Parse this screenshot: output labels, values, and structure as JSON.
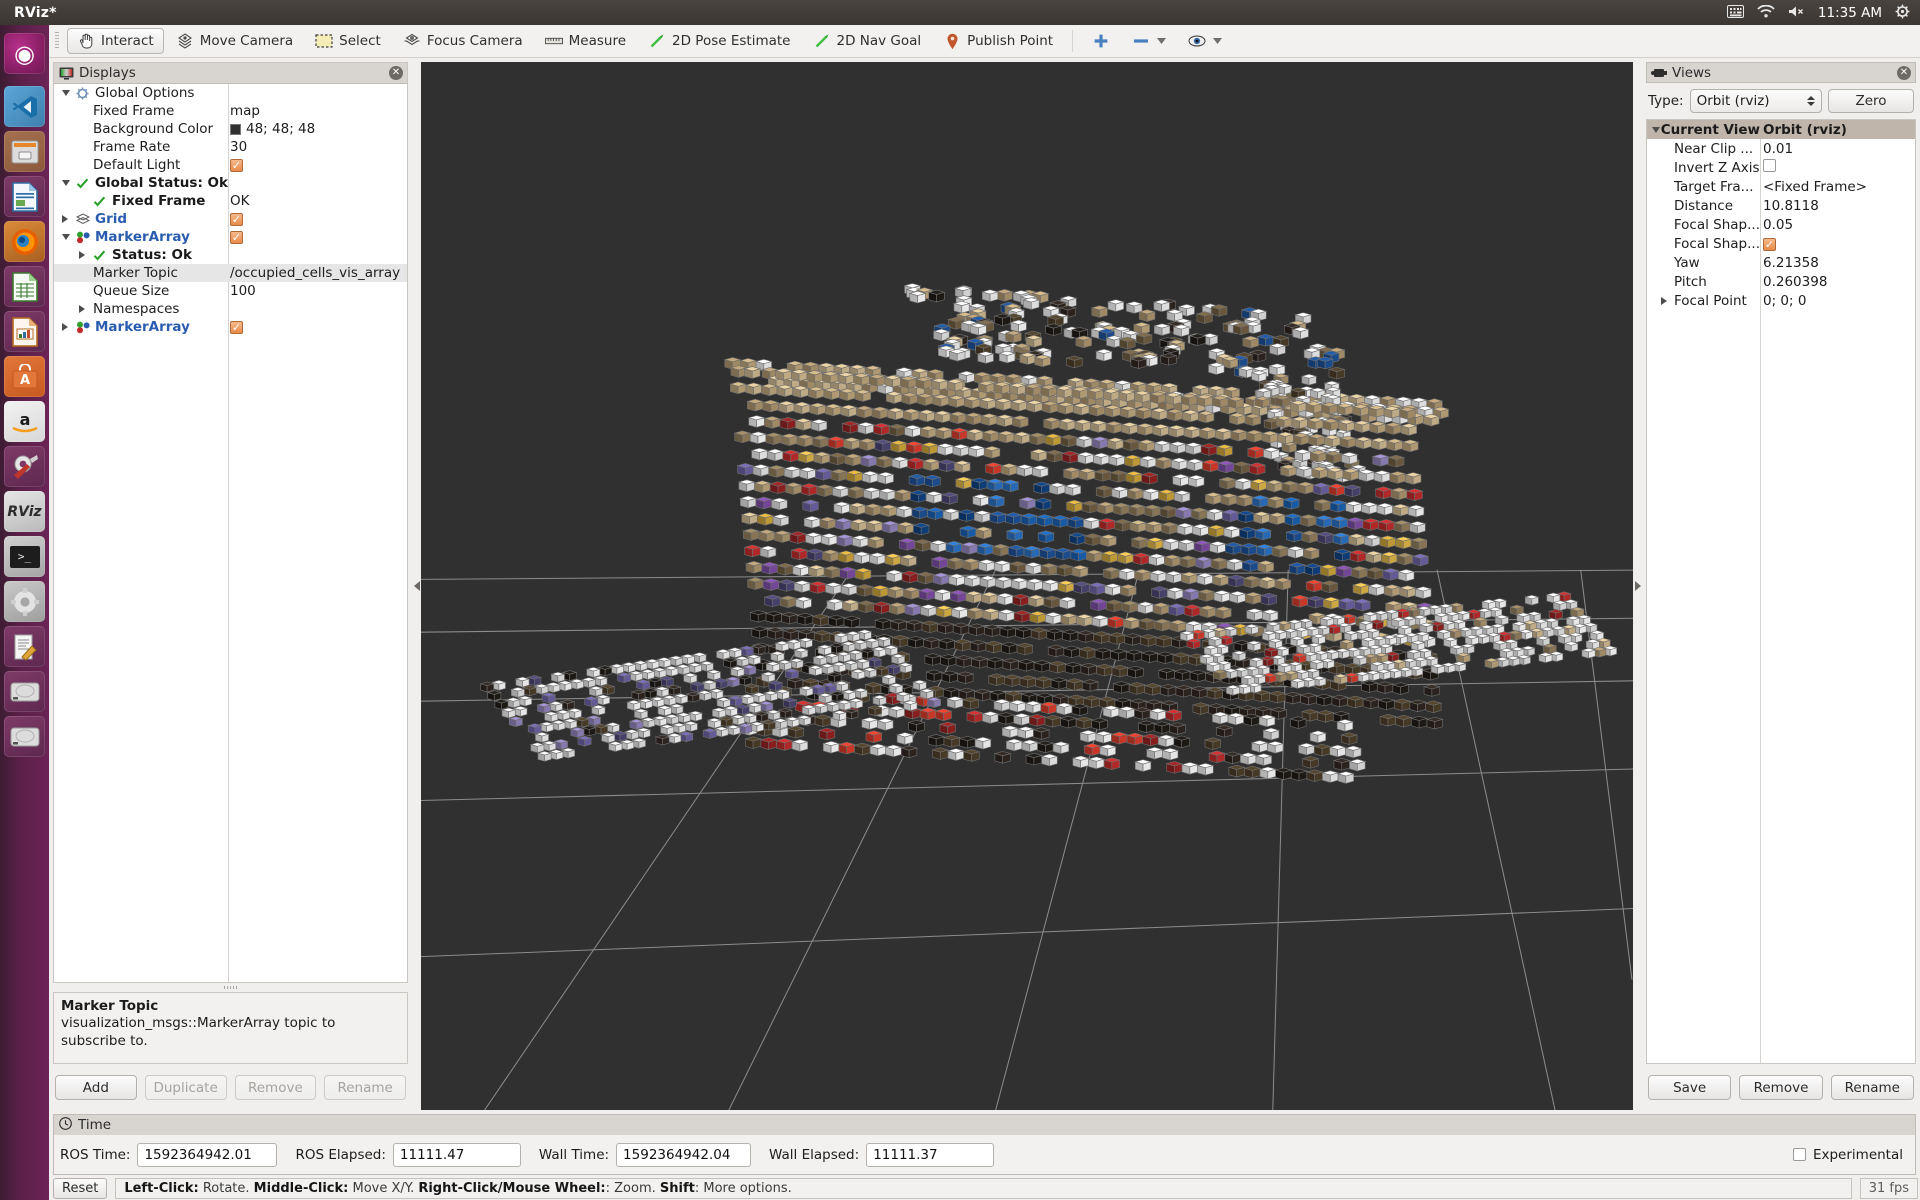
{
  "window": {
    "title": "RViz*"
  },
  "topbar": {
    "clock": "11:35 AM",
    "icons": [
      "keyboard-icon",
      "wifi-icon",
      "volume-muted-icon",
      "power-gear-icon"
    ]
  },
  "launcher": {
    "items": [
      {
        "name": "ubuntu-dash",
        "label": "Ubuntu"
      },
      {
        "name": "vscode",
        "label": "VS"
      },
      {
        "name": "files",
        "label": "Files"
      },
      {
        "name": "libreoffice-writer",
        "label": "Writer"
      },
      {
        "name": "firefox",
        "label": "Firefox"
      },
      {
        "name": "libreoffice-calc",
        "label": "Calc"
      },
      {
        "name": "libreoffice-impress",
        "label": "Impress"
      },
      {
        "name": "ubuntu-software",
        "label": "A"
      },
      {
        "name": "amazon",
        "label": "a"
      },
      {
        "name": "system-tools",
        "label": "Tools"
      },
      {
        "name": "rviz",
        "label": "RViz"
      },
      {
        "name": "terminal",
        "label": ">_"
      },
      {
        "name": "settings",
        "label": "Settings"
      },
      {
        "name": "text-editor",
        "label": "Editor"
      },
      {
        "name": "disk-1",
        "label": "Disk"
      },
      {
        "name": "disk-2",
        "label": "Disk"
      }
    ]
  },
  "toolbar": {
    "buttons": [
      {
        "label": "Interact",
        "icon": "hand-cursor-icon",
        "active": true
      },
      {
        "label": "Move Camera",
        "icon": "move-camera-icon",
        "active": false
      },
      {
        "label": "Select",
        "icon": "select-rect-icon",
        "active": false
      },
      {
        "label": "Focus Camera",
        "icon": "focus-camera-icon",
        "active": false
      },
      {
        "label": "Measure",
        "icon": "ruler-icon",
        "active": false
      },
      {
        "label": "2D Pose Estimate",
        "icon": "pose-arrow-icon",
        "active": false
      },
      {
        "label": "2D Nav Goal",
        "icon": "nav-goal-arrow-icon",
        "active": false
      },
      {
        "label": "Publish Point",
        "icon": "map-pin-icon",
        "active": false
      }
    ],
    "tools": [
      {
        "name": "add-tool-icon",
        "glyph": "+"
      },
      {
        "name": "remove-tool-icon",
        "glyph": "-"
      },
      {
        "name": "visibility-eye-icon",
        "glyph": "eye"
      }
    ]
  },
  "displays": {
    "panel_title": "Displays",
    "column_widths": "name/value",
    "rows": [
      {
        "indent": 0,
        "expander": "down",
        "icon": "gear-icon",
        "name": "Global Options",
        "style": "plain",
        "value": "",
        "value_type": "text"
      },
      {
        "indent": 1,
        "expander": "none",
        "icon": "",
        "name": "Fixed Frame",
        "style": "plain",
        "value": "map",
        "value_type": "text"
      },
      {
        "indent": 1,
        "expander": "none",
        "icon": "",
        "name": "Background Color",
        "style": "plain",
        "value": "48; 48; 48",
        "value_type": "color",
        "color": "#303030"
      },
      {
        "indent": 1,
        "expander": "none",
        "icon": "",
        "name": "Frame Rate",
        "style": "plain",
        "value": "30",
        "value_type": "text"
      },
      {
        "indent": 1,
        "expander": "none",
        "icon": "",
        "name": "Default Light",
        "style": "plain",
        "value": "",
        "value_type": "checkbox_on"
      },
      {
        "indent": 0,
        "expander": "down",
        "icon": "check-icon",
        "name": "Global Status: Ok",
        "style": "bold",
        "value": "",
        "value_type": "text"
      },
      {
        "indent": 1,
        "expander": "none",
        "icon": "check-icon",
        "name": "Fixed Frame",
        "style": "bold",
        "value": "OK",
        "value_type": "text"
      },
      {
        "indent": 0,
        "expander": "right",
        "icon": "grid-icon",
        "name": "Grid",
        "style": "link",
        "value": "",
        "value_type": "checkbox_on"
      },
      {
        "indent": 0,
        "expander": "down",
        "icon": "markerarray-icon",
        "name": "MarkerArray",
        "style": "link",
        "value": "",
        "value_type": "checkbox_on"
      },
      {
        "indent": 1,
        "expander": "right",
        "icon": "check-icon",
        "name": "Status: Ok",
        "style": "bold",
        "value": "",
        "value_type": "text"
      },
      {
        "indent": 1,
        "expander": "none",
        "icon": "",
        "name": "Marker Topic",
        "style": "plain",
        "value": "/occupied_cells_vis_array",
        "value_type": "text",
        "selected": true
      },
      {
        "indent": 1,
        "expander": "none",
        "icon": "",
        "name": "Queue Size",
        "style": "plain",
        "value": "100",
        "value_type": "text"
      },
      {
        "indent": 1,
        "expander": "right",
        "icon": "",
        "name": "Namespaces",
        "style": "plain",
        "value": "",
        "value_type": "text"
      },
      {
        "indent": 0,
        "expander": "right",
        "icon": "markerarray-icon",
        "name": "MarkerArray",
        "style": "link",
        "value": "",
        "value_type": "checkbox_on"
      }
    ],
    "description": {
      "title": "Marker Topic",
      "text": "visualization_msgs::MarkerArray topic to subscribe to."
    },
    "buttons": [
      {
        "label": "Add",
        "enabled": true
      },
      {
        "label": "Duplicate",
        "enabled": false
      },
      {
        "label": "Remove",
        "enabled": false
      },
      {
        "label": "Rename",
        "enabled": false
      }
    ]
  },
  "views": {
    "panel_title": "Views",
    "type_label": "Type:",
    "type_value": "Orbit (rviz)",
    "zero_button": "Zero",
    "header": {
      "name": "Current View",
      "value": "Orbit (rviz)"
    },
    "rows": [
      {
        "indent": 1,
        "expander": "none",
        "name": "Near Clip ...",
        "value": "0.01",
        "value_type": "text"
      },
      {
        "indent": 1,
        "expander": "none",
        "name": "Invert Z Axis",
        "value": "",
        "value_type": "checkbox_off"
      },
      {
        "indent": 1,
        "expander": "none",
        "name": "Target Fra...",
        "value": "<Fixed Frame>",
        "value_type": "text"
      },
      {
        "indent": 1,
        "expander": "none",
        "name": "Distance",
        "value": "10.8118",
        "value_type": "text"
      },
      {
        "indent": 1,
        "expander": "none",
        "name": "Focal Shap...",
        "value": "0.05",
        "value_type": "text"
      },
      {
        "indent": 1,
        "expander": "none",
        "name": "Focal Shap...",
        "value": "",
        "value_type": "checkbox_on"
      },
      {
        "indent": 1,
        "expander": "none",
        "name": "Yaw",
        "value": "6.21358",
        "value_type": "text"
      },
      {
        "indent": 1,
        "expander": "none",
        "name": "Pitch",
        "value": "0.260398",
        "value_type": "text"
      },
      {
        "indent": 1,
        "expander": "right",
        "name": "Focal Point",
        "value": "0; 0; 0",
        "value_type": "text"
      }
    ],
    "buttons": [
      {
        "label": "Save",
        "enabled": true
      },
      {
        "label": "Remove",
        "enabled": true
      },
      {
        "label": "Rename",
        "enabled": true
      }
    ]
  },
  "time": {
    "panel_title": "Time",
    "fields": [
      {
        "label": "ROS Time:",
        "value": "1592364942.01"
      },
      {
        "label": "ROS Elapsed:",
        "value": "11111.47"
      },
      {
        "label": "Wall Time:",
        "value": "1592364942.04"
      },
      {
        "label": "Wall Elapsed:",
        "value": "11111.37"
      }
    ],
    "experimental_label": "Experimental",
    "experimental_checked": false
  },
  "statusbar": {
    "reset_label": "Reset",
    "hint_parts": [
      {
        "text": "Left-Click:",
        "bold": true
      },
      {
        "text": " Rotate. ",
        "bold": false
      },
      {
        "text": "Middle-Click:",
        "bold": true
      },
      {
        "text": " Move X/Y. ",
        "bold": false
      },
      {
        "text": "Right-Click/Mouse Wheel:",
        "bold": true
      },
      {
        "text": ": Zoom. ",
        "bold": false
      },
      {
        "text": "Shift",
        "bold": true
      },
      {
        "text": ": More options.",
        "bold": false
      }
    ],
    "fps": "31 fps"
  },
  "viewport": {
    "background_color": "#303030",
    "grid_color": "#9a9a9a",
    "scene_description": "OctoMap occupied-cell voxel grid of a shelf / box with colored cubes"
  },
  "colors": {
    "accent_blue": "#2a5db0",
    "checkbox_orange": "#e88c4a",
    "status_green": "#2aa02a",
    "panel_bg": "#f0efee",
    "dock_title_bg": "#d8d5d1",
    "tree_header_bg": "#bfb5ab"
  }
}
